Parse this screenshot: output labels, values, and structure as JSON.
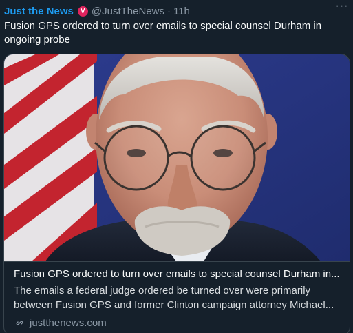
{
  "tweet": {
    "author_name": "Just the News",
    "badge_letter": "V",
    "handle": "@JustTheNews",
    "separator": "·",
    "time": "11h",
    "more_label": "···",
    "text": "Fusion GPS ordered to turn over emails to special counsel Durham in ongoing probe"
  },
  "card": {
    "image": "portrait-photo",
    "title": "Fusion GPS ordered to turn over emails to special counsel Durham in...",
    "description_line1": "The emails a federal judge ordered be turned over were primarily",
    "description_line2": "between Fusion GPS and former Clinton campaign attorney Michael...",
    "domain": "justthenews.com"
  },
  "colors": {
    "background": "#15202b",
    "accent": "#1d9bf0",
    "badge": "#e0245e",
    "secondary_text": "#8b98a5",
    "border": "#38444d"
  },
  "icons": {
    "badge": "verified-badge-icon",
    "more": "more-options-icon",
    "link": "link-icon"
  }
}
